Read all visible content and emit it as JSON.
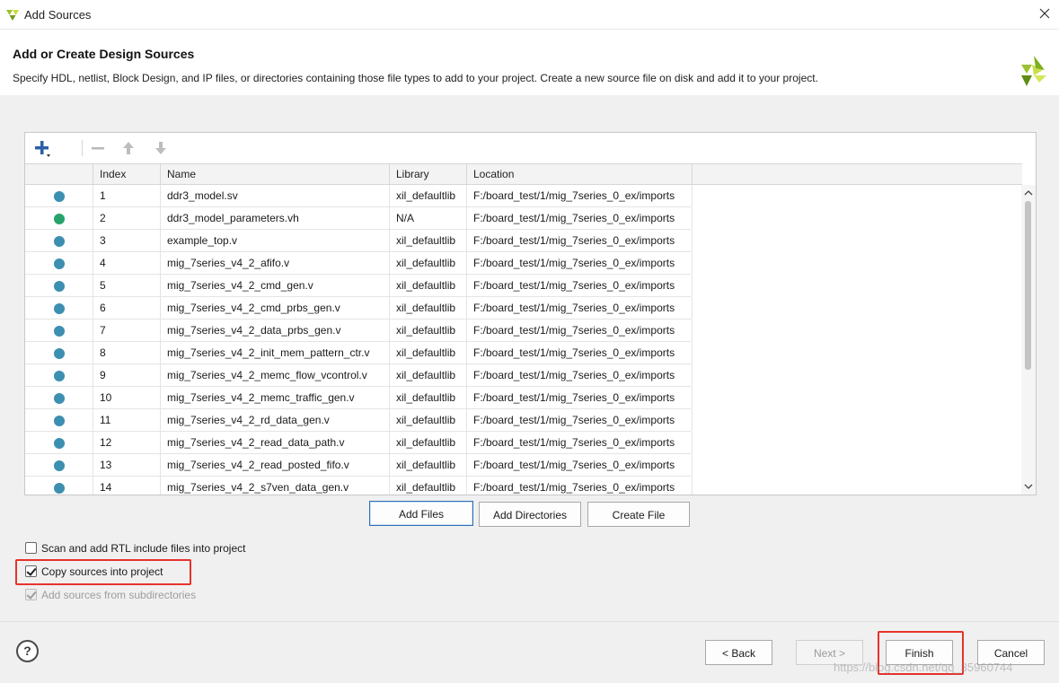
{
  "window": {
    "title": "Add Sources"
  },
  "header": {
    "title": "Add or Create Design Sources",
    "description": "Specify HDL, netlist, Block Design, and IP files, or directories containing those file types to add to your project. Create a new source file on disk and add it to your project."
  },
  "toolbar": {
    "add_icon": "plus-icon",
    "remove_icon": "minus-icon",
    "up_icon": "arrow-up-icon",
    "down_icon": "arrow-down-icon"
  },
  "table": {
    "columns": [
      "Index",
      "Name",
      "Library",
      "Location"
    ],
    "rows": [
      {
        "index": "1",
        "name": "ddr3_model.sv",
        "library": "xil_defaultlib",
        "location": "F:/board_test/1/mig_7series_0_ex/imports",
        "status": "blue"
      },
      {
        "index": "2",
        "name": "ddr3_model_parameters.vh",
        "library": "N/A",
        "location": "F:/board_test/1/mig_7series_0_ex/imports",
        "status": "green"
      },
      {
        "index": "3",
        "name": "example_top.v",
        "library": "xil_defaultlib",
        "location": "F:/board_test/1/mig_7series_0_ex/imports",
        "status": "blue"
      },
      {
        "index": "4",
        "name": "mig_7series_v4_2_afifo.v",
        "library": "xil_defaultlib",
        "location": "F:/board_test/1/mig_7series_0_ex/imports",
        "status": "blue"
      },
      {
        "index": "5",
        "name": "mig_7series_v4_2_cmd_gen.v",
        "library": "xil_defaultlib",
        "location": "F:/board_test/1/mig_7series_0_ex/imports",
        "status": "blue"
      },
      {
        "index": "6",
        "name": "mig_7series_v4_2_cmd_prbs_gen.v",
        "library": "xil_defaultlib",
        "location": "F:/board_test/1/mig_7series_0_ex/imports",
        "status": "blue"
      },
      {
        "index": "7",
        "name": "mig_7series_v4_2_data_prbs_gen.v",
        "library": "xil_defaultlib",
        "location": "F:/board_test/1/mig_7series_0_ex/imports",
        "status": "blue"
      },
      {
        "index": "8",
        "name": "mig_7series_v4_2_init_mem_pattern_ctr.v",
        "library": "xil_defaultlib",
        "location": "F:/board_test/1/mig_7series_0_ex/imports",
        "status": "blue"
      },
      {
        "index": "9",
        "name": "mig_7series_v4_2_memc_flow_vcontrol.v",
        "library": "xil_defaultlib",
        "location": "F:/board_test/1/mig_7series_0_ex/imports",
        "status": "blue"
      },
      {
        "index": "10",
        "name": "mig_7series_v4_2_memc_traffic_gen.v",
        "library": "xil_defaultlib",
        "location": "F:/board_test/1/mig_7series_0_ex/imports",
        "status": "blue"
      },
      {
        "index": "11",
        "name": "mig_7series_v4_2_rd_data_gen.v",
        "library": "xil_defaultlib",
        "location": "F:/board_test/1/mig_7series_0_ex/imports",
        "status": "blue"
      },
      {
        "index": "12",
        "name": "mig_7series_v4_2_read_data_path.v",
        "library": "xil_defaultlib",
        "location": "F:/board_test/1/mig_7series_0_ex/imports",
        "status": "blue"
      },
      {
        "index": "13",
        "name": "mig_7series_v4_2_read_posted_fifo.v",
        "library": "xil_defaultlib",
        "location": "F:/board_test/1/mig_7series_0_ex/imports",
        "status": "blue"
      },
      {
        "index": "14",
        "name": "mig_7series_v4_2_s7ven_data_gen.v",
        "library": "xil_defaultlib",
        "location": "F:/board_test/1/mig_7series_0_ex/imports",
        "status": "blue"
      }
    ]
  },
  "actions": {
    "add_files": "Add Files",
    "add_directories": "Add Directories",
    "create_file": "Create File"
  },
  "options": {
    "scan_rtl": {
      "label": "Scan and add RTL include files into project",
      "checked": false
    },
    "copy_sources": {
      "label": "Copy sources into project",
      "checked": true
    },
    "add_subdirs": {
      "label": "Add sources from subdirectories",
      "checked": true,
      "disabled": true
    }
  },
  "footer": {
    "help": "?",
    "back": "< Back",
    "next": "Next >",
    "finish": "Finish",
    "cancel": "Cancel",
    "watermark": "https://blog.csdn.net/qq_35960744"
  },
  "colors": {
    "status_blue": "#3c8fb0",
    "status_green": "#26a36b",
    "highlight_red": "#e8322c",
    "brand_green": "#8fbf2a"
  }
}
